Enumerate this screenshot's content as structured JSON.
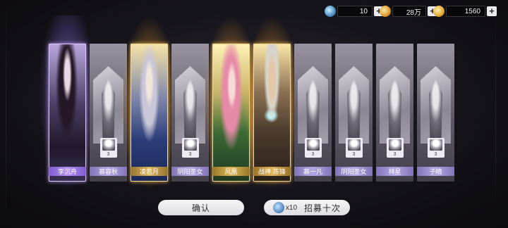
{
  "currencies": [
    {
      "icon": "jade-gem-icon",
      "value": "10"
    },
    {
      "icon": "gold-coin-icon",
      "value": "28万"
    },
    {
      "icon": "gold-ingot-icon",
      "value": "1560"
    }
  ],
  "cards": [
    {
      "name": "李沉舟",
      "kind": "hero",
      "glow": "purple",
      "star": ""
    },
    {
      "name": "慕容秋",
      "kind": "minor",
      "star": "3"
    },
    {
      "name": "凌若月",
      "kind": "hero",
      "glow": "gold",
      "star": ""
    },
    {
      "name": "阴阳圣女",
      "kind": "minor",
      "star": "3"
    },
    {
      "name": "风凰",
      "kind": "hero",
      "glow": "gold",
      "star": ""
    },
    {
      "name": "战神·陈锋",
      "kind": "hero",
      "glow": "gold",
      "star": ""
    },
    {
      "name": "慕一凡",
      "kind": "minor",
      "star": "3"
    },
    {
      "name": "阴阳圣女",
      "kind": "minor",
      "star": "3"
    },
    {
      "name": "林星",
      "kind": "minor",
      "star": "3"
    },
    {
      "name": "子晴",
      "kind": "minor",
      "star": "3"
    }
  ],
  "buttons": {
    "confirm": "确认",
    "recruit_cost": "x10",
    "recruit_label": "招募十次"
  },
  "colors": {
    "gold_glow": "#ffc43c",
    "purple_glow": "#be96ff",
    "name_purple": "#a888f0"
  }
}
